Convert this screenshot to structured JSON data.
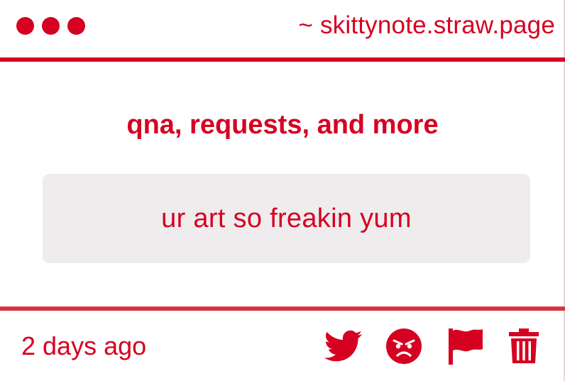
{
  "titlebar": {
    "site_url": "~ skittynote.straw.page"
  },
  "main": {
    "heading": "qna, requests, and more",
    "message": "ur art so freakin yum"
  },
  "footer": {
    "timestamp": "2 days ago",
    "actions": [
      "twitter-icon",
      "angry-face-icon",
      "flag-icon",
      "trash-icon"
    ]
  },
  "colors": {
    "accent": "#d60021",
    "message_background": "#eeeced"
  }
}
